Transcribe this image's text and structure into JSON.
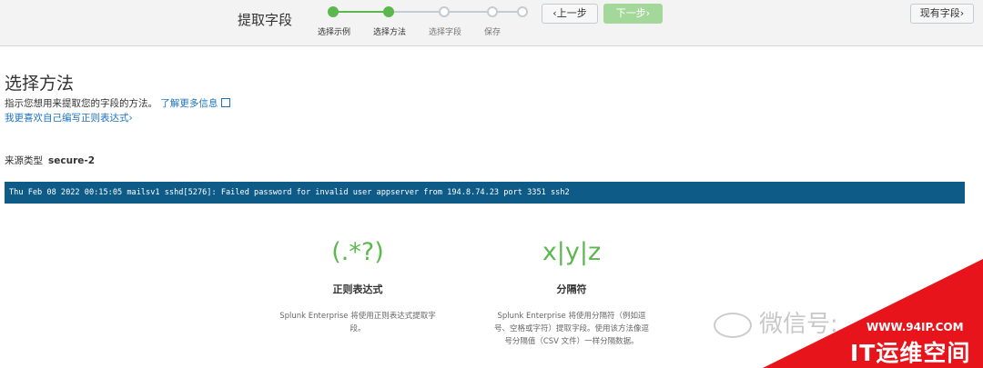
{
  "header": {
    "title": "提取字段",
    "steps": [
      {
        "label": "选择示例",
        "state": "done"
      },
      {
        "label": "选择方法",
        "state": "current"
      },
      {
        "label": "选择字段",
        "state": "pending"
      },
      {
        "label": "保存",
        "state": "pending"
      }
    ],
    "prev_label": "‹上一步",
    "next_label": "下一步›",
    "existing_fields_label": "现有字段›"
  },
  "main": {
    "title": "选择方法",
    "description": "指示您想用来提取您的字段的方法。",
    "learn_more": "了解更多信息",
    "regex_link": "我更喜欢自己编写正则表达式›",
    "source_type_label": "来源类型",
    "source_type_value": "secure-2",
    "event": "Thu Feb 08 2022 00:15:05 mailsv1 sshd[5276]: Failed password for invalid user appserver from 194.8.74.23 port 3351 ssh2"
  },
  "methods": [
    {
      "icon": "(.*?)",
      "name": "正则表达式",
      "description": "Splunk Enterprise 将使用正则表达式提取字段。"
    },
    {
      "icon": "x|y|z",
      "name": "分隔符",
      "description": "Splunk Enterprise 将使用分隔符（例如逗号、空格或字符）提取字段。使用该方法像逗号分隔值（CSV 文件）一样分隔数据。"
    }
  ],
  "watermark": {
    "wechat": "微信号:",
    "site_url": "WWW.94IP.COM",
    "site_name": "IT运维空间"
  },
  "colors": {
    "accent_green": "#5cb84e",
    "event_bar": "#0e5b87",
    "link": "#1e73be",
    "banner_red": "#e8141b"
  }
}
